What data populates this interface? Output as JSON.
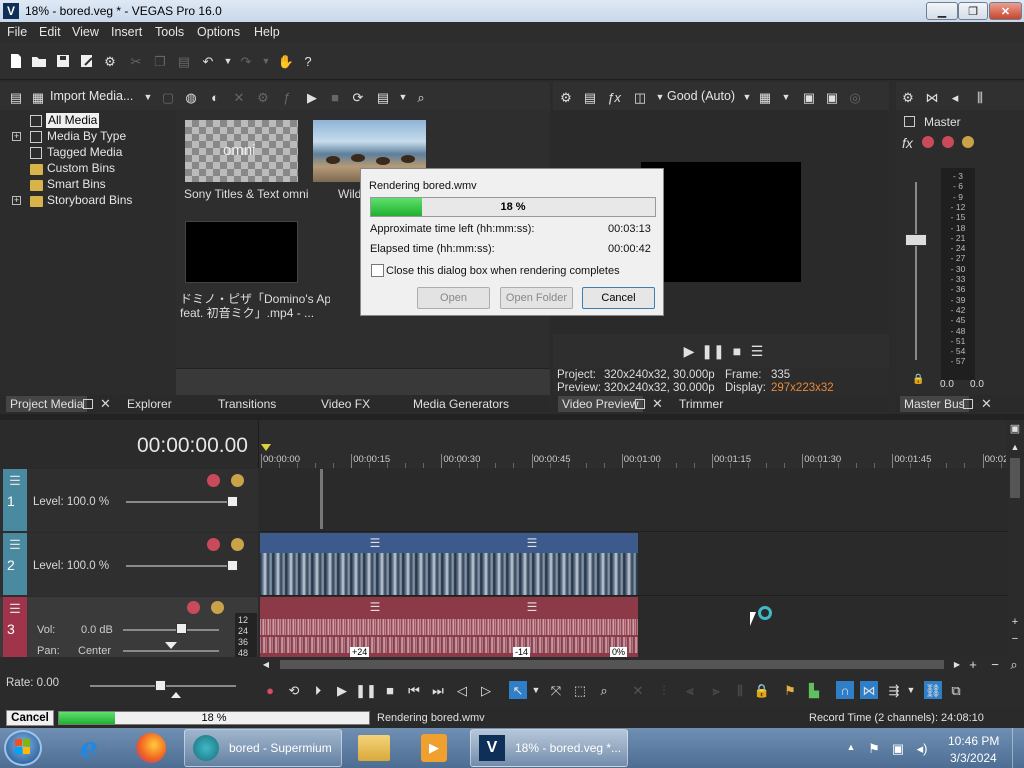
{
  "window": {
    "title": "18% - bored.veg * - VEGAS Pro 16.0",
    "logo": "V",
    "minimize": "▁",
    "maximize": "❐",
    "close": "✕"
  },
  "menu": [
    "File",
    "Edit",
    "View",
    "Insert",
    "Tools",
    "Options",
    "Help"
  ],
  "project_media": {
    "import_label": "Import Media...",
    "tree": [
      {
        "label": "All Media",
        "selected": true
      },
      {
        "label": "Media By Type",
        "expandable": true
      },
      {
        "label": "Tagged Media"
      },
      {
        "label": "Custom Bins"
      },
      {
        "label": "Smart Bins"
      },
      {
        "label": "Storyboard Bins",
        "expandable": true
      }
    ],
    "items": [
      {
        "label": "Sony Titles & Text omni",
        "thumb_text": "omni"
      },
      {
        "label": "Wild"
      },
      {
        "label_line1": "ドミノ・ピザ「Domino's App",
        "label_line2": "feat. 初音ミク」.mp4 - ..."
      }
    ]
  },
  "lower_tabs_left": {
    "project_media": "Project Media",
    "explorer": "Explorer",
    "transitions": "Transitions",
    "video_fx": "Video FX",
    "media_generators": "Media Generators"
  },
  "preview": {
    "quality": "Good (Auto)",
    "project_label": "Project:",
    "project_value": "320x240x32, 30.000p",
    "preview_label": "Preview:",
    "preview_value": "320x240x32, 30.000p",
    "frame_label": "Frame:",
    "frame_value": "335",
    "display_label": "Display:",
    "display_value": "297x223x32",
    "tab_video_preview": "Video Preview",
    "tab_trimmer": "Trimmer"
  },
  "master": {
    "label": "Master",
    "fx": "fx",
    "scale": [
      "3",
      "6",
      "9",
      "12",
      "15",
      "18",
      "21",
      "24",
      "27",
      "30",
      "33",
      "36",
      "39",
      "42",
      "45",
      "48",
      "51",
      "54",
      "57"
    ],
    "left_value": "0.0",
    "right_value": "0.0",
    "tab": "Master Bus"
  },
  "dialog": {
    "title": "Rendering bored.wmv",
    "progress_percent": 18,
    "progress_text": "18 %",
    "time_left_label": "Approximate time left (hh:mm:ss):",
    "time_left_value": "00:03:13",
    "elapsed_label": "Elapsed time (hh:mm:ss):",
    "elapsed_value": "00:00:42",
    "close_checkbox": "Close this dialog box when rendering completes",
    "open_button": "Open",
    "open_folder_button": "Open Folder",
    "cancel_button": "Cancel"
  },
  "timeline": {
    "timecode": "00:00:00.00",
    "ruler": [
      "00:00:00",
      "00:00:15",
      "00:00:30",
      "00:00:45",
      "00:01:00",
      "00:01:15",
      "00:01:30",
      "00:01:45",
      "00:02"
    ],
    "tracks": [
      {
        "number": "1",
        "level": "Level: 100.0 %"
      },
      {
        "number": "2",
        "level": "Level: 100.0 %"
      },
      {
        "number": "3",
        "vol_label": "Vol:",
        "vol_value": "0.0 dB",
        "pan_label": "Pan:",
        "pan_value": "Center",
        "meter_ticks": [
          "12",
          "24",
          "36",
          "48"
        ]
      }
    ],
    "audio_badges": [
      "+24",
      "-14",
      "0%"
    ],
    "rate": "Rate: 0.00"
  },
  "status": {
    "cancel": "Cancel",
    "progress_percent": 18,
    "progress_text": "18 %",
    "message": "Rendering bored.wmv",
    "record_time": "Record Time (2 channels): 24:08:10"
  },
  "taskbar": {
    "apps": [
      {
        "label": "bored - Supermium"
      },
      {
        "label": "18% - bored.veg *..."
      }
    ],
    "time": "10:46 PM",
    "date": "3/3/2024"
  },
  "colors": {
    "progress_green": "#22c33a",
    "preview_orange": "#e8893a",
    "video_clip": "#3d5a8c",
    "audio_clip": "#8c3a48",
    "track_teal": "#4a8aa0",
    "track_red": "#a0344a"
  }
}
